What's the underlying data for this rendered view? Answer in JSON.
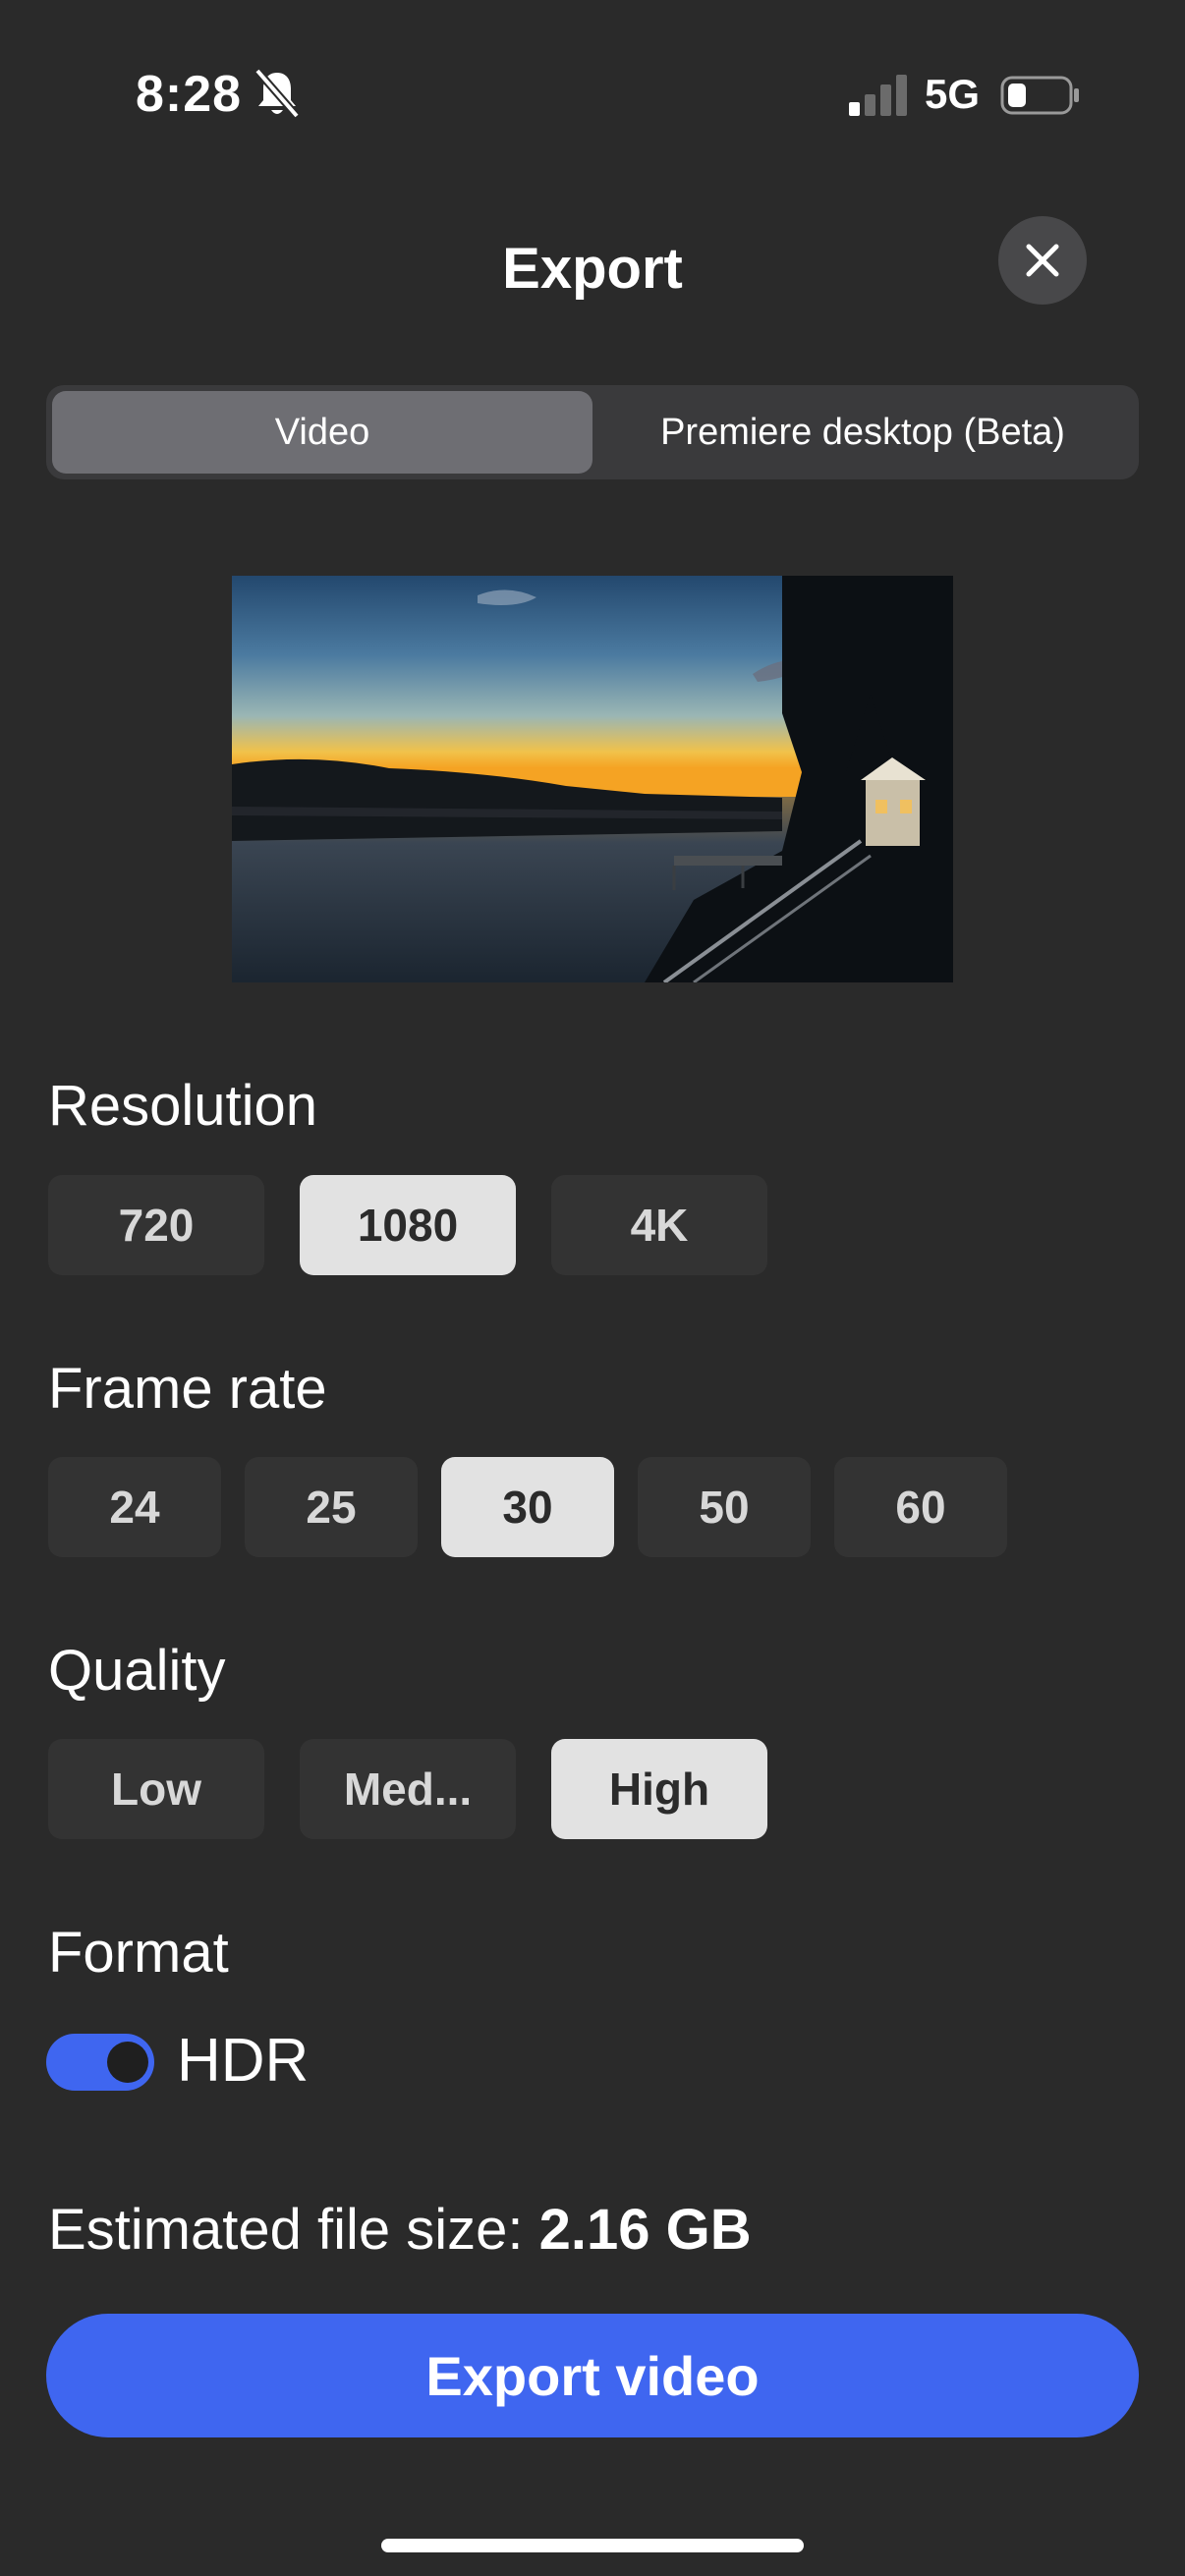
{
  "status_bar": {
    "time": "8:28",
    "network": "5G",
    "icons": [
      "bell-slash-icon",
      "signal-icon",
      "battery-icon"
    ]
  },
  "header": {
    "title": "Export",
    "close_icon": "close-icon"
  },
  "tabs": [
    {
      "label": "Video",
      "active": true
    },
    {
      "label": "Premiere desktop (Beta)",
      "active": false
    }
  ],
  "resolution": {
    "label": "Resolution",
    "options": [
      "720",
      "1080",
      "4K"
    ],
    "selected": "1080"
  },
  "frame_rate": {
    "label": "Frame rate",
    "options": [
      "24",
      "25",
      "30",
      "50",
      "60"
    ],
    "selected": "30"
  },
  "quality": {
    "label": "Quality",
    "options": [
      "Low",
      "Med...",
      "High"
    ],
    "selected": "High"
  },
  "format": {
    "label": "Format",
    "hdr_label": "HDR",
    "hdr_enabled": true
  },
  "file_size": {
    "label": "Estimated file size:",
    "value": "2.16 GB"
  },
  "export_button": "Export video",
  "colors": {
    "background": "#2a2a2a",
    "accent": "#3f66f0",
    "chip": "#333333",
    "chip_selected": "#e2e2e2"
  }
}
